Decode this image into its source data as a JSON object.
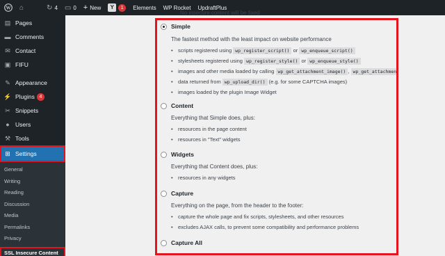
{
  "adminbar": {
    "updates_count": "4",
    "comments_count": "0",
    "new_label": "New",
    "yoast_badge": "1",
    "items": [
      "Elements",
      "WP Rocket",
      "UpdraftPlus"
    ]
  },
  "sidebar": {
    "items": [
      {
        "label": "Pages",
        "icon": "pages-icon"
      },
      {
        "label": "Comments",
        "icon": "comments-icon"
      },
      {
        "label": "Contact",
        "icon": "contact-icon"
      },
      {
        "label": "FIFU",
        "icon": "fifu-icon"
      },
      {
        "label": "Appearance",
        "icon": "appearance-icon"
      },
      {
        "label": "Plugins",
        "badge": "4",
        "icon": "plugins-icon"
      },
      {
        "label": "Snippets",
        "icon": "snippets-icon"
      },
      {
        "label": "Users",
        "icon": "users-icon"
      },
      {
        "label": "Tools",
        "icon": "tools-icon"
      },
      {
        "label": "Settings",
        "icon": "settings-icon"
      }
    ],
    "submenu": [
      "General",
      "Writing",
      "Reading",
      "Discussion",
      "Media",
      "Permalinks",
      "Privacy",
      "SSL Insecure Content"
    ]
  },
  "top_note": "No insecure content will be fixed",
  "options": [
    {
      "title": "Simple",
      "checked": true,
      "desc": "The fastest method with the least impact on website performance",
      "items": [
        {
          "parts": [
            "scripts registered using ",
            {
              "code": "wp_register_script()"
            },
            " or ",
            {
              "code": "wp_enqueue_script()"
            }
          ]
        },
        {
          "parts": [
            "stylesheets registered using ",
            {
              "code": "wp_register_style()"
            },
            " or ",
            {
              "code": "wp_enqueue_style()"
            }
          ]
        },
        {
          "parts": [
            "images and other media loaded by calling ",
            {
              "code": "wp_get_attachment_image()"
            },
            ", ",
            {
              "code": "wp_get_attachment_image_src"
            }
          ]
        },
        {
          "parts": [
            "data returned from ",
            {
              "code": "wp_upload_dir()"
            },
            " (e.g. for some CAPTCHA images)"
          ]
        },
        {
          "parts": [
            "images loaded by the plugin Image Widget"
          ]
        }
      ]
    },
    {
      "title": "Content",
      "checked": false,
      "desc": "Everything that Simple does, plus:",
      "items": [
        {
          "parts": [
            "resources in the page content"
          ]
        },
        {
          "parts": [
            "resources in \"Text\" widgets"
          ]
        }
      ]
    },
    {
      "title": "Widgets",
      "checked": false,
      "desc": "Everything that Content does, plus:",
      "items": [
        {
          "parts": [
            "resources in any widgets"
          ]
        }
      ]
    },
    {
      "title": "Capture",
      "checked": false,
      "desc": "Everything on the page, from the header to the footer:",
      "items": [
        {
          "parts": [
            "capture the whole page and fix scripts, stylesheets, and other resources"
          ]
        },
        {
          "parts": [
            "excludes AJAX calls, to prevent some compatibility and performance problems"
          ]
        }
      ]
    },
    {
      "title": "Capture All",
      "checked": false,
      "desc": "",
      "items": []
    }
  ],
  "colors": {
    "admin_bg": "#1d2327",
    "accent": "#2271b1",
    "highlight": "#e3141e"
  }
}
